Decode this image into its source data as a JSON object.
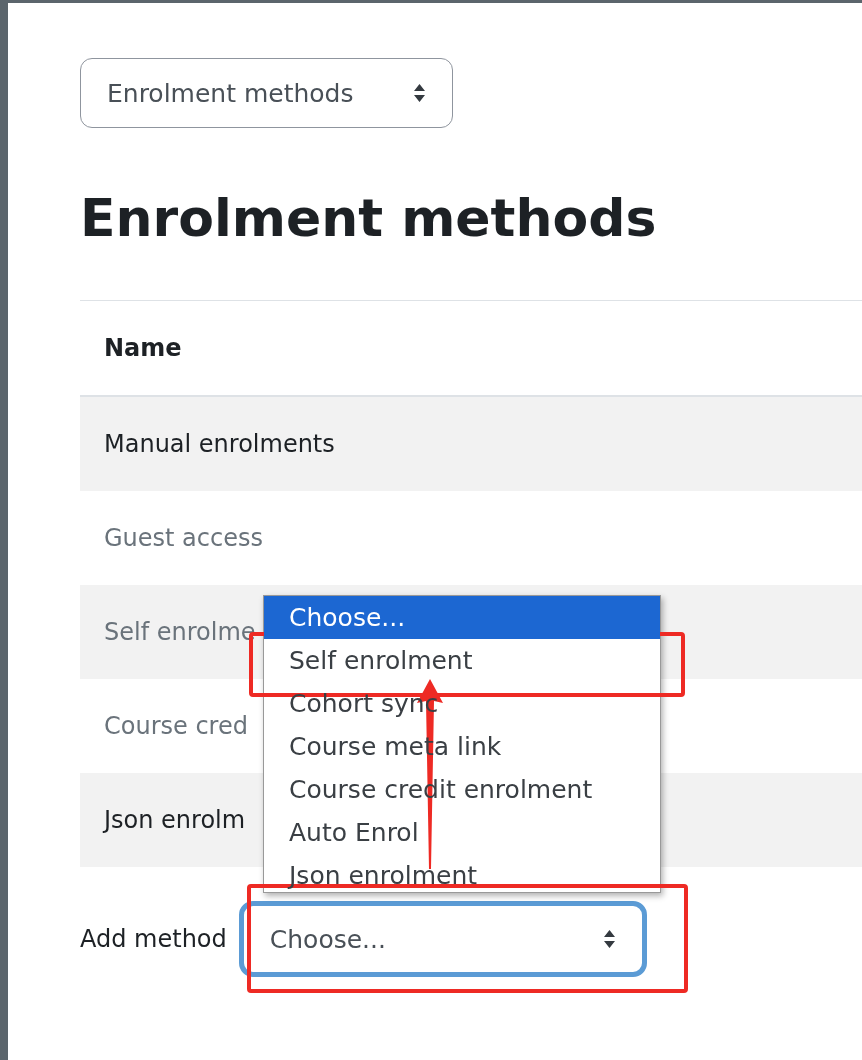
{
  "page_select": {
    "value": "Enrolment methods"
  },
  "heading": "Enrolment methods",
  "table": {
    "columns": [
      "Name"
    ],
    "rows": [
      {
        "name": "Manual enrolments",
        "disabled": false
      },
      {
        "name": "Guest access",
        "disabled": true
      },
      {
        "name": "Self enrolme",
        "disabled": true
      },
      {
        "name": "Course cred",
        "disabled": true
      },
      {
        "name": "Json enrolm",
        "disabled": false
      }
    ]
  },
  "add_method": {
    "label": "Add method",
    "value": "Choose...",
    "focused": true,
    "options": [
      {
        "label": "Choose...",
        "selected": true
      },
      {
        "label": "Self enrolment",
        "selected": false
      },
      {
        "label": "Cohort sync",
        "selected": false
      },
      {
        "label": "Course meta link",
        "selected": false
      },
      {
        "label": "Course credit enrolment",
        "selected": false
      },
      {
        "label": "Auto Enrol",
        "selected": false
      },
      {
        "label": "Json enrolment",
        "selected": false
      }
    ]
  }
}
